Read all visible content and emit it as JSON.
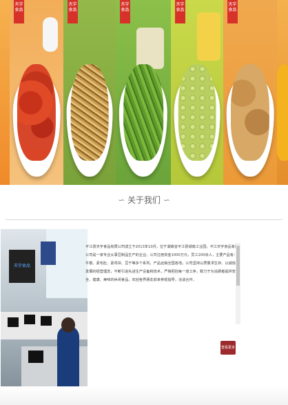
{
  "banner": {
    "logo_text": "天宇食品",
    "tiles": [
      "spicy-chicken",
      "noodle-sticks",
      "green-beans",
      "green-peas",
      "rice-crisps",
      "partial"
    ]
  },
  "about": {
    "title": "关于我们",
    "deco_left": "∽",
    "deco_right": "∽",
    "office_logo_text": "天宇食品",
    "body": "平江县天宇食品有限公司成立于2013年10月，位于湖南省平江县城南工业园，平江天宇食品有限公司是一家专业从事豆制品生产的企业，公司注册资金1000万元，员工200余人，主要产品有：素牛筋、素毛肚、素鸡块、豆干等多个系列，产品远销全国各地。公司坚持以质量求生存、以诚信谋发展的经营理念，不断引进先进生产设备和技术，严格把控每一道工序，致力于为消费者提供安全、健康、美味的休闲食品，欢迎各界朋友前来参观指导，洽谈合作。",
    "more_label": "查看更多"
  },
  "colors": {
    "button_bg": "#9c2a2c",
    "logo_red": "#d7322a"
  }
}
